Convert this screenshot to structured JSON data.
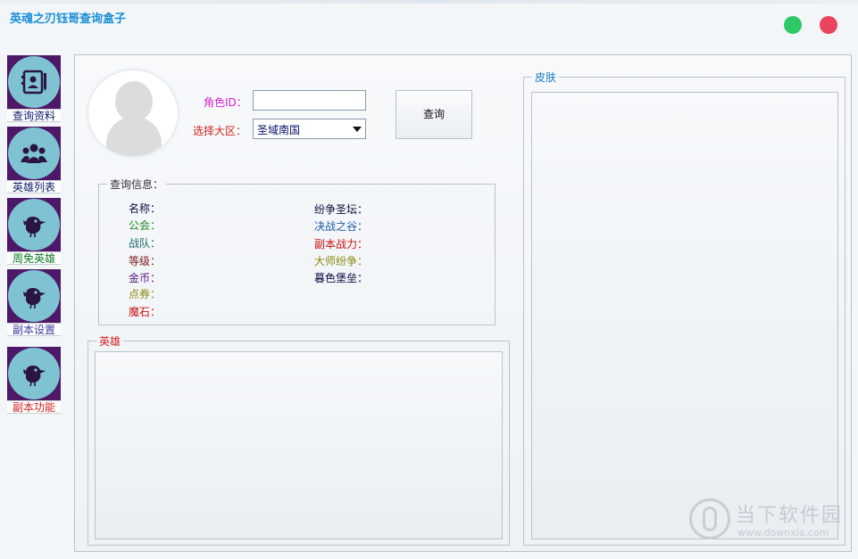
{
  "app": {
    "title": "英魂之刃钰哥查询盒子"
  },
  "window_controls": {
    "minimize_color": "#2ec866",
    "close_color": "#ea4461"
  },
  "sidebar": {
    "items": [
      {
        "label": "查询资料",
        "color": "#0b1d6b",
        "icon": "profile-card-icon"
      },
      {
        "label": "英雄列表",
        "color": "#0b1d6b",
        "icon": "group-icon"
      },
      {
        "label": "周免英雄",
        "color": "#0a7a22",
        "icon": "bird-icon"
      },
      {
        "label": "副本设置",
        "color": "#3b3ba0",
        "icon": "bird-icon"
      },
      {
        "label": "副本功能",
        "color": "#d42020",
        "icon": "bird-icon"
      }
    ],
    "tile_color": "#4d1868",
    "circle_color": "#7fc3d3"
  },
  "query": {
    "role_id_label": "角色ID：",
    "role_id_value": "",
    "region_label": "选择大区：",
    "region_value": "圣域南国",
    "query_button": "查询"
  },
  "info_group": {
    "title": "查询信息：",
    "left": [
      {
        "label": "名称：",
        "color": "#0b0b40"
      },
      {
        "label": "公会：",
        "color": "#1f8a1f"
      },
      {
        "label": "战队：",
        "color": "#1b6b6b"
      },
      {
        "label": "等级：",
        "color": "#7a1a1a"
      },
      {
        "label": "金币：",
        "color": "#5a1a7a"
      },
      {
        "label": "点券：",
        "color": "#8a8a10"
      },
      {
        "label": "魔石：",
        "color": "#cc1010"
      }
    ],
    "right": [
      {
        "label": "纷争圣坛：",
        "color": "#0b0b40"
      },
      {
        "label": "决战之谷：",
        "color": "#1a5aa8"
      },
      {
        "label": "副本战力：",
        "color": "#cc1010"
      },
      {
        "label": "大师纷争：",
        "color": "#8a8a10"
      },
      {
        "label": "暮色堡垒：",
        "color": "#0b0b40"
      }
    ]
  },
  "heroes_group": {
    "title": "英雄"
  },
  "skins_group": {
    "title": "皮肤"
  },
  "watermark": {
    "text": "当下软件园",
    "url": "www.downxia.com"
  }
}
